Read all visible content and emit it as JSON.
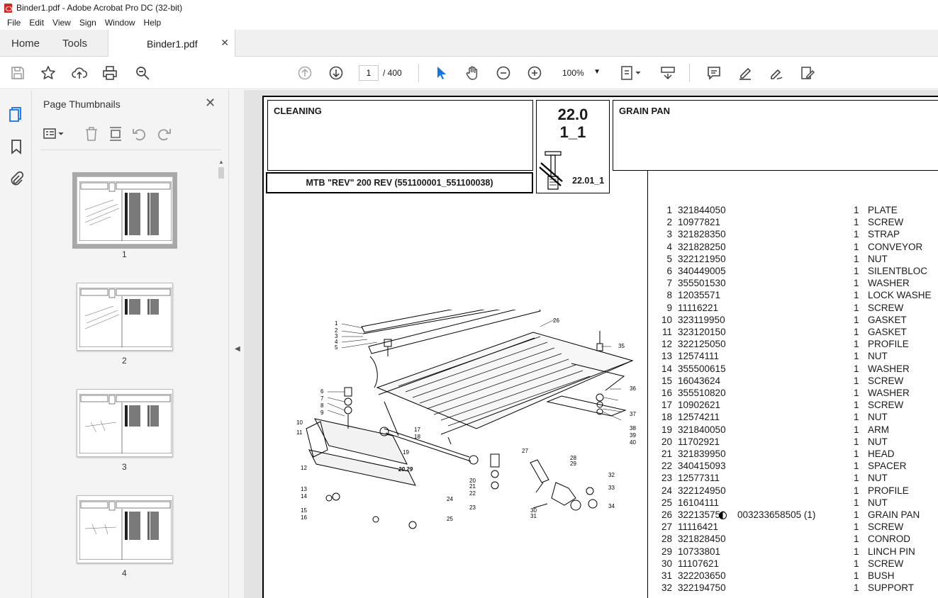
{
  "window": {
    "title": "Binder1.pdf - Adobe Acrobat Pro DC (32-bit)"
  },
  "menu": [
    "File",
    "Edit",
    "View",
    "Sign",
    "Window",
    "Help"
  ],
  "tabs": {
    "home": "Home",
    "tools": "Tools",
    "document": "Binder1.pdf"
  },
  "toolbar": {
    "page_current": "1",
    "page_total": "/ 400",
    "zoom": "100%"
  },
  "thumbnails": {
    "title": "Page Thumbnails",
    "pages": [
      "1",
      "2",
      "3",
      "4"
    ],
    "selected": "1"
  },
  "page": {
    "section": "CLEANING",
    "subsection": "GRAIN PAN",
    "model": "MTB \"REV\" 200 REV (551100001_551100038)",
    "ref_number": "22.0",
    "ref_sub": "1_1",
    "ref_link": "22.01_1",
    "diagram_labels": [
      "1",
      "2",
      "3",
      "4",
      "5",
      "6",
      "7",
      "8",
      "9",
      "10",
      "11",
      "12",
      "13",
      "14",
      "15",
      "16",
      "17",
      "18",
      "19",
      "20",
      "21",
      "22",
      "23",
      "24",
      "25",
      "26",
      "27",
      "28",
      "29",
      "30",
      "31",
      "32",
      "33",
      "34",
      "35",
      "36",
      "37",
      "38",
      "39",
      "40",
      "20.29"
    ],
    "parts": [
      {
        "pos": "1",
        "code": "321844050",
        "note": "",
        "qty": "1",
        "desc": "PLATE"
      },
      {
        "pos": "2",
        "code": "10977821",
        "note": "",
        "qty": "1",
        "desc": "SCREW"
      },
      {
        "pos": "3",
        "code": "321828350",
        "note": "",
        "qty": "1",
        "desc": "STRAP"
      },
      {
        "pos": "4",
        "code": "321828250",
        "note": "",
        "qty": "1",
        "desc": "CONVEYOR"
      },
      {
        "pos": "5",
        "code": "322121950",
        "note": "",
        "qty": "1",
        "desc": "NUT"
      },
      {
        "pos": "6",
        "code": "340449005",
        "note": "",
        "qty": "1",
        "desc": "SILENTBLOC"
      },
      {
        "pos": "7",
        "code": "355501530",
        "note": "",
        "qty": "1",
        "desc": "WASHER"
      },
      {
        "pos": "8",
        "code": "12035571",
        "note": "",
        "qty": "1",
        "desc": "LOCK WASHE"
      },
      {
        "pos": "9",
        "code": "11116221",
        "note": "",
        "qty": "1",
        "desc": "SCREW"
      },
      {
        "pos": "10",
        "code": "323119950",
        "note": "",
        "qty": "1",
        "desc": "GASKET"
      },
      {
        "pos": "11",
        "code": "323120150",
        "note": "",
        "qty": "1",
        "desc": "GASKET"
      },
      {
        "pos": "12",
        "code": "322125050",
        "note": "",
        "qty": "1",
        "desc": "PROFILE"
      },
      {
        "pos": "13",
        "code": "12574111",
        "note": "",
        "qty": "1",
        "desc": "NUT"
      },
      {
        "pos": "14",
        "code": "355500615",
        "note": "",
        "qty": "1",
        "desc": "WASHER"
      },
      {
        "pos": "15",
        "code": "16043624",
        "note": "",
        "qty": "1",
        "desc": "SCREW"
      },
      {
        "pos": "16",
        "code": "355510820",
        "note": "",
        "qty": "1",
        "desc": "WASHER"
      },
      {
        "pos": "17",
        "code": "10902621",
        "note": "",
        "qty": "1",
        "desc": "SCREW"
      },
      {
        "pos": "18",
        "code": "12574211",
        "note": "",
        "qty": "1",
        "desc": "NUT"
      },
      {
        "pos": "19",
        "code": "321840050",
        "note": "",
        "qty": "1",
        "desc": "ARM"
      },
      {
        "pos": "20",
        "code": "11702921",
        "note": "",
        "qty": "1",
        "desc": "NUT"
      },
      {
        "pos": "21",
        "code": "321839950",
        "note": "",
        "qty": "1",
        "desc": "HEAD"
      },
      {
        "pos": "22",
        "code": "340415093",
        "note": "",
        "qty": "1",
        "desc": "SPACER"
      },
      {
        "pos": "23",
        "code": "12577311",
        "note": "",
        "qty": "1",
        "desc": "NUT"
      },
      {
        "pos": "24",
        "code": "322124950",
        "note": "",
        "qty": "1",
        "desc": "PROFILE"
      },
      {
        "pos": "25",
        "code": "16104111",
        "note": "",
        "qty": "1",
        "desc": "NUT"
      },
      {
        "pos": "26",
        "code": "322135750",
        "note": "003233658505  (1)",
        "qty": "1",
        "desc": "GRAIN PAN"
      },
      {
        "pos": "27",
        "code": "11116421",
        "note": "",
        "qty": "1",
        "desc": "SCREW"
      },
      {
        "pos": "28",
        "code": "321828450",
        "note": "",
        "qty": "1",
        "desc": "CONROD"
      },
      {
        "pos": "29",
        "code": "10733801",
        "note": "",
        "qty": "1",
        "desc": "LINCH PIN"
      },
      {
        "pos": "30",
        "code": "11107621",
        "note": "",
        "qty": "1",
        "desc": "SCREW"
      },
      {
        "pos": "31",
        "code": "322203650",
        "note": "",
        "qty": "1",
        "desc": "BUSH"
      },
      {
        "pos": "32",
        "code": "322194750",
        "note": "",
        "qty": "1",
        "desc": "SUPPORT"
      }
    ]
  }
}
